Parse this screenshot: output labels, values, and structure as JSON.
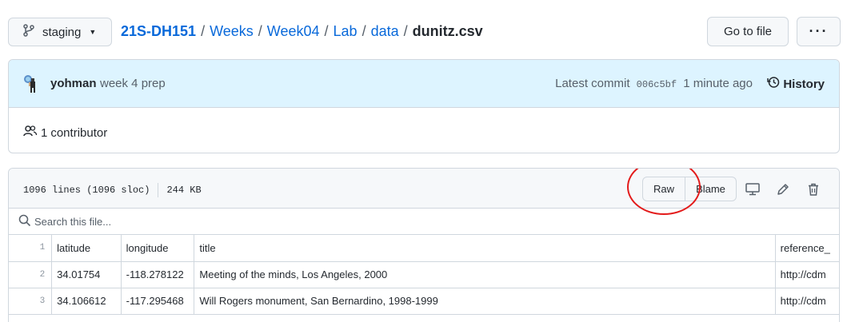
{
  "topbar": {
    "branch": "staging",
    "breadcrumb": {
      "repo": "21S-DH151",
      "parts": [
        "Weeks",
        "Week04",
        "Lab",
        "data"
      ],
      "file": "dunitz.csv",
      "separator": "/"
    },
    "goto_label": "Go to file",
    "more_label": "···"
  },
  "commit": {
    "author": "yohman",
    "message": "week 4 prep",
    "latest_label": "Latest commit",
    "sha": "006c5bf",
    "time": "1 minute ago",
    "history_label": "History",
    "contributor_count": "1",
    "contributor_label": "contributor"
  },
  "file": {
    "lines_info": "1096 lines (1096 sloc)",
    "size": "244 KB",
    "raw_label": "Raw",
    "blame_label": "Blame",
    "search_placeholder": "Search this file..."
  },
  "table": {
    "rows": [
      {
        "ln": "1",
        "cells": [
          "latitude",
          "longitude",
          "title",
          "reference_"
        ]
      },
      {
        "ln": "2",
        "cells": [
          "34.01754",
          "-118.278122",
          "Meeting of the minds, Los Angeles, 2000",
          "http://cdm"
        ]
      },
      {
        "ln": "3",
        "cells": [
          "34.106612",
          "-117.295468",
          "Will Rogers monument, San Bernardino, 1998-1999",
          "http://cdm"
        ]
      }
    ]
  },
  "colors": {
    "accent": "#0969da",
    "commit_bg": "#ddf4ff",
    "highlight": "#e31b1b"
  }
}
